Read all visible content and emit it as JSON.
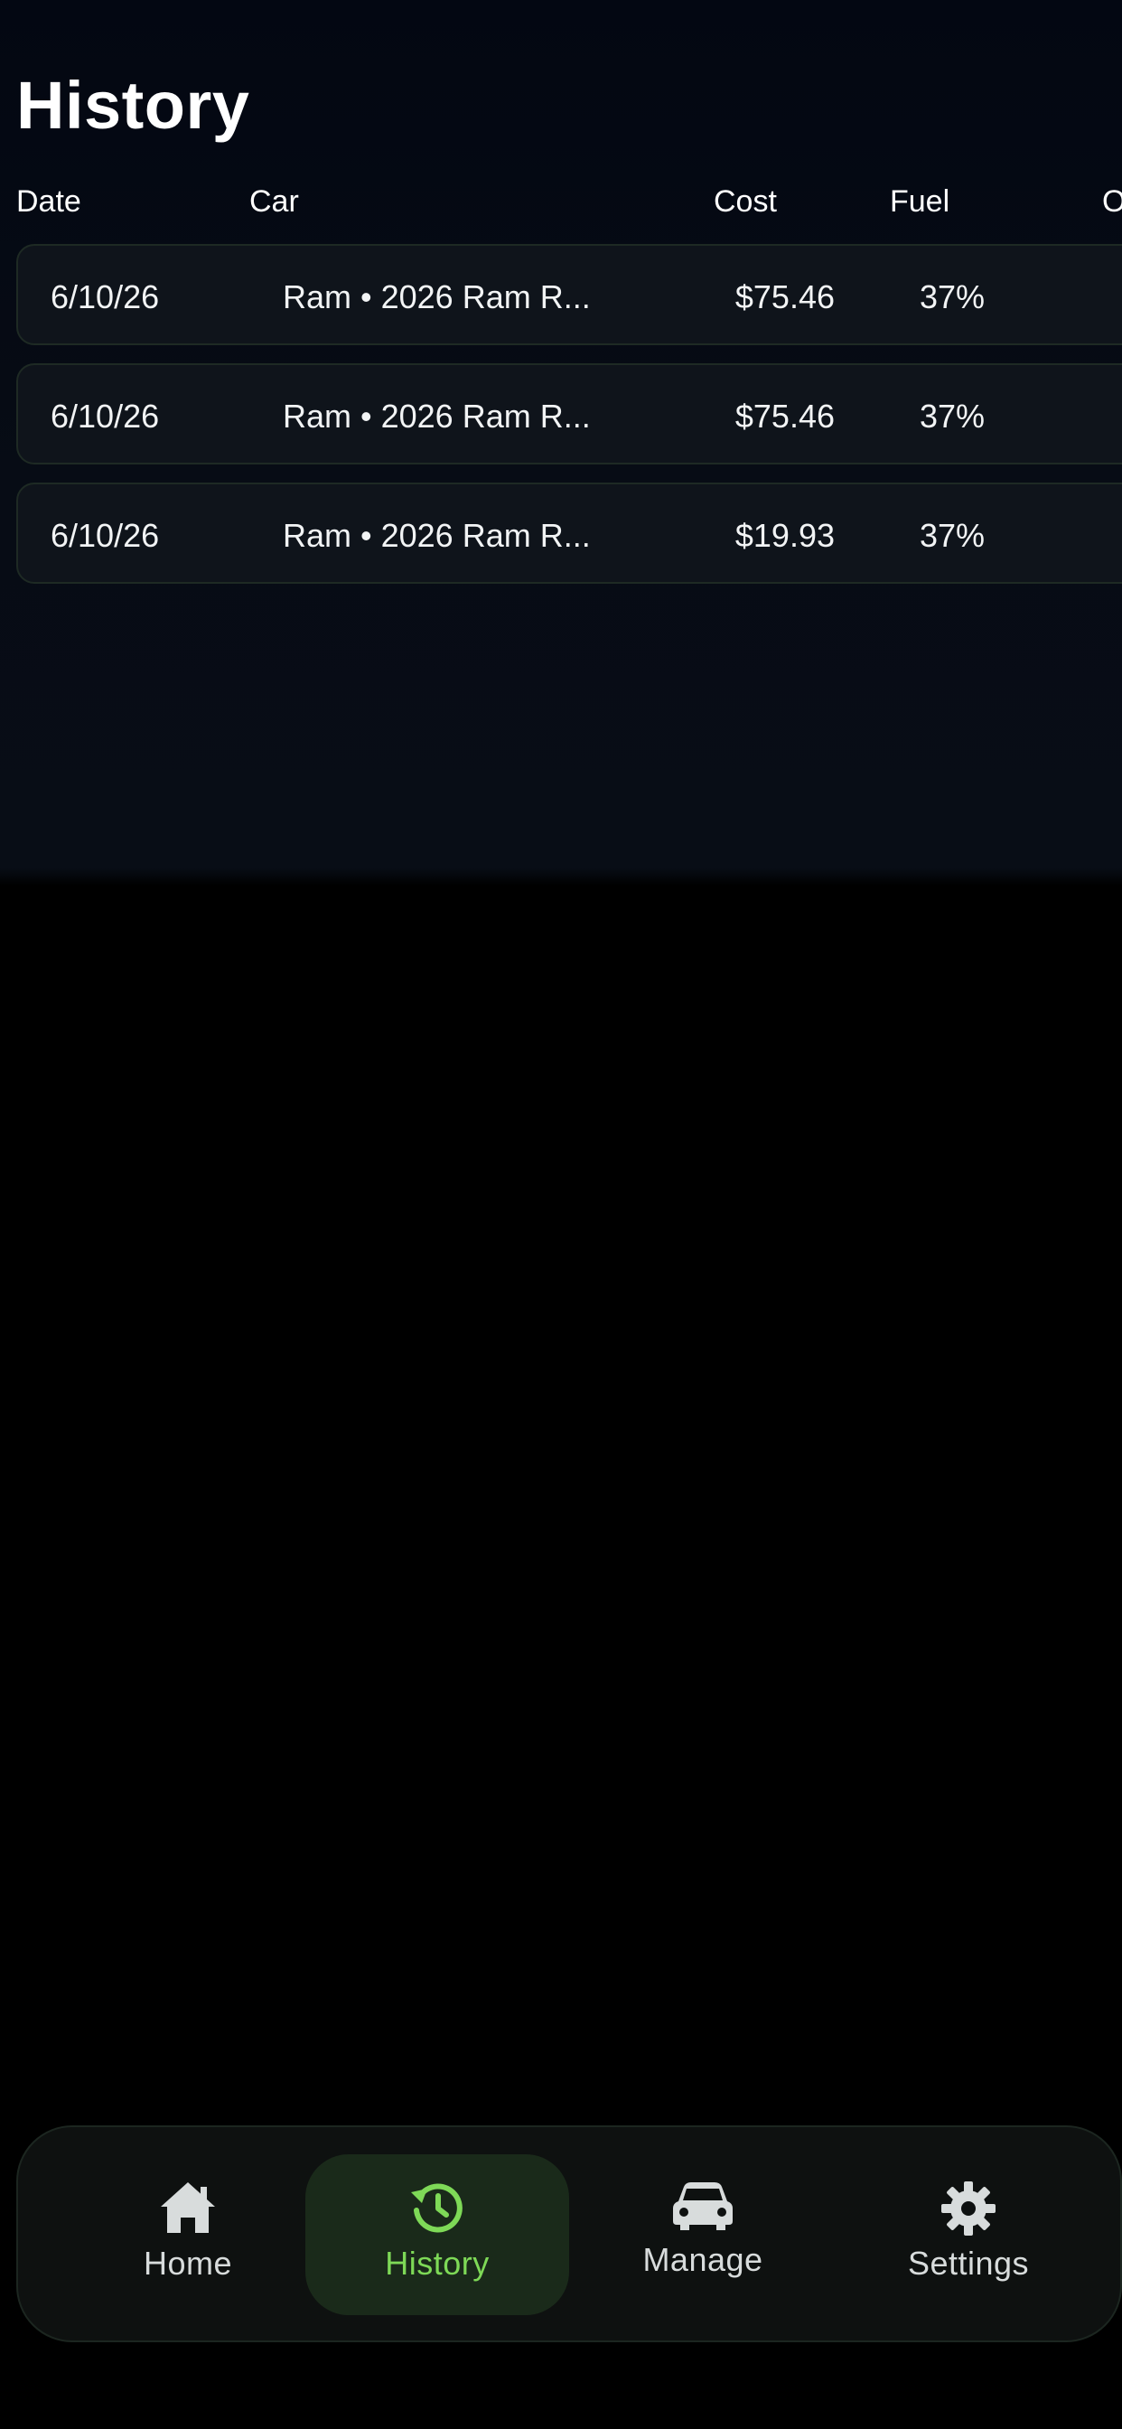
{
  "header": {
    "title": "History"
  },
  "table": {
    "columns": [
      "Date",
      "Car",
      "Cost",
      "Fuel",
      "O"
    ],
    "rows": [
      {
        "date": "6/10/26",
        "car": "Ram • 2026 Ram R...",
        "cost": "$75.46",
        "fuel": "37%"
      },
      {
        "date": "6/10/26",
        "car": "Ram • 2026 Ram R...",
        "cost": "$75.46",
        "fuel": "37%"
      },
      {
        "date": "6/10/26",
        "car": "Ram • 2026 Ram R...",
        "cost": "$19.93",
        "fuel": "37%"
      }
    ]
  },
  "tabbar": {
    "tabs": [
      {
        "label": "Home",
        "icon": "home-icon",
        "active": false
      },
      {
        "label": "History",
        "icon": "history-icon",
        "active": true
      },
      {
        "label": "Manage",
        "icon": "car-icon",
        "active": false
      },
      {
        "label": "Settings",
        "icon": "gear-icon",
        "active": false
      }
    ]
  },
  "colors": {
    "accent": "#7ed957",
    "background": "#000000",
    "row_background": "#0f141b"
  }
}
